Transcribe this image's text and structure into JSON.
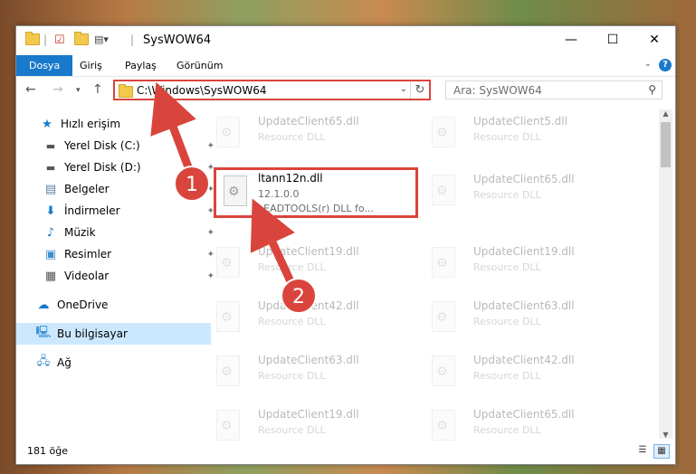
{
  "window": {
    "title": "SysWOW64",
    "controls": {
      "minimize": "—",
      "maximize": "☐",
      "close": "✕"
    }
  },
  "ribbon": {
    "tabs": [
      {
        "label": "Dosya",
        "active": true
      },
      {
        "label": "Giriş"
      },
      {
        "label": "Paylaş"
      },
      {
        "label": "Görünüm"
      }
    ],
    "help": "?"
  },
  "nav": {
    "address": "C:\\Windows\\SysWOW64",
    "search_placeholder": "Ara: SysWOW64"
  },
  "sidebar": {
    "items": [
      {
        "label": "Hızlı erişim",
        "icon": "star-icon"
      },
      {
        "label": "Yerel Disk (C:)",
        "icon": "drive-icon",
        "pinned": true
      },
      {
        "label": "Yerel Disk (D:)",
        "icon": "drive-icon",
        "pinned": true
      },
      {
        "label": "Belgeler",
        "icon": "documents-icon",
        "pinned": true
      },
      {
        "label": "İndirmeler",
        "icon": "downloads-icon",
        "pinned": true
      },
      {
        "label": "Müzik",
        "icon": "music-icon",
        "pinned": true
      },
      {
        "label": "Resimler",
        "icon": "pictures-icon",
        "pinned": true
      },
      {
        "label": "Videolar",
        "icon": "videos-icon",
        "pinned": true
      },
      {
        "label": "OneDrive",
        "icon": "cloud-icon"
      },
      {
        "label": "Bu bilgisayar",
        "icon": "computer-icon",
        "selected": true
      },
      {
        "label": "Ağ",
        "icon": "network-icon"
      }
    ]
  },
  "files": {
    "left_column": [
      {
        "name": "UpdateClient65.dll",
        "type": "Resource DLL"
      },
      {
        "name": "ltann12n.dll",
        "version": "12.1.0.0",
        "desc": "LEADTOOLS(r) DLL fo...",
        "highlighted": true
      },
      {
        "name": "UpdateClient19.dll",
        "type": "Resource DLL"
      },
      {
        "name": "UpdateClient42.dll",
        "type": "Resource DLL"
      },
      {
        "name": "UpdateClient63.dll",
        "type": "Resource DLL"
      },
      {
        "name": "UpdateClient19.dll",
        "type": "Resource DLL"
      }
    ],
    "right_column": [
      {
        "name": "UpdateClient5.dll",
        "type": "Resource DLL"
      },
      {
        "name": "UpdateClient65.dll",
        "type": "Resource DLL"
      },
      {
        "name": "UpdateClient19.dll",
        "type": "Resource DLL"
      },
      {
        "name": "UpdateClient63.dll",
        "type": "Resource DLL"
      },
      {
        "name": "UpdateClient42.dll",
        "type": "Resource DLL"
      },
      {
        "name": "UpdateClient65.dll",
        "type": "Resource DLL"
      }
    ]
  },
  "status": {
    "count": "181 öğe"
  },
  "annotations": {
    "step1": "1",
    "step2": "2",
    "color": "#d9453c"
  }
}
